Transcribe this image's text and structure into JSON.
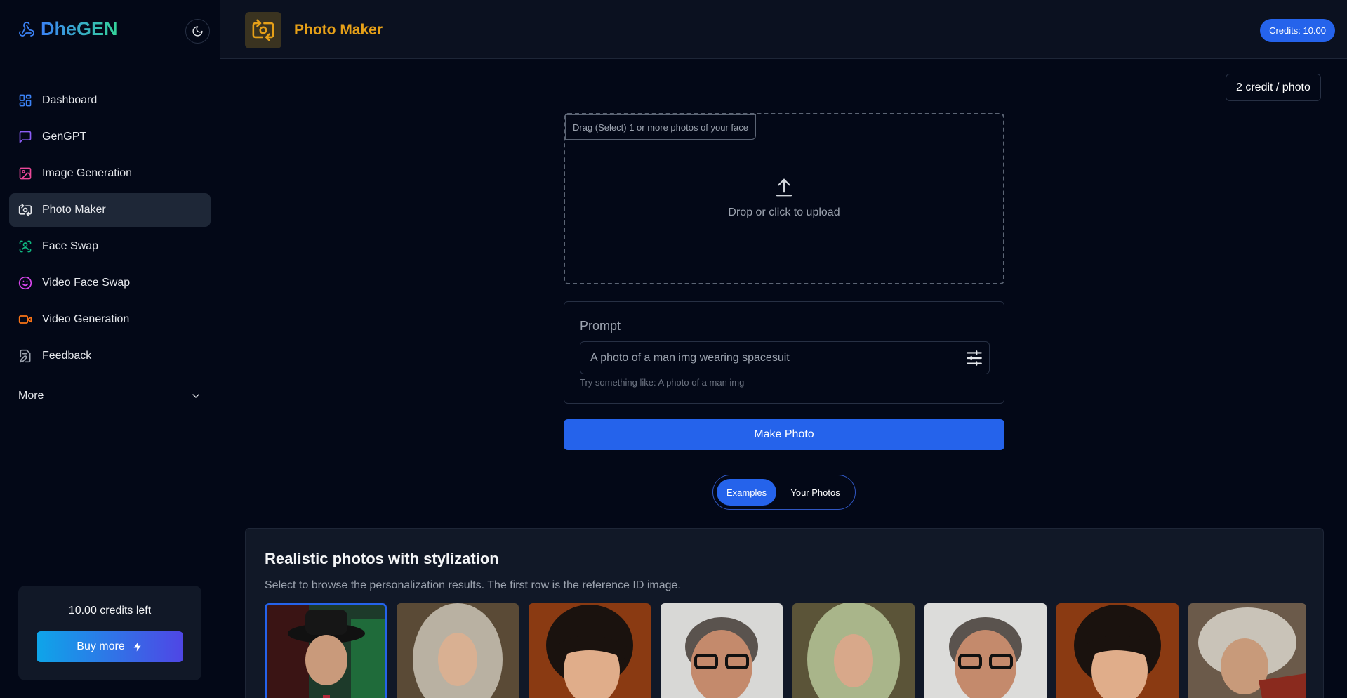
{
  "app": {
    "name": "DheGEN"
  },
  "sidebar": {
    "items": [
      {
        "label": "Dashboard",
        "icon": "dashboard-icon",
        "color": "#3b82f6"
      },
      {
        "label": "GenGPT",
        "icon": "chat-icon",
        "color": "#8b5cf6"
      },
      {
        "label": "Image Generation",
        "icon": "image-icon",
        "color": "#ec4899"
      },
      {
        "label": "Photo Maker",
        "icon": "photo-maker-icon",
        "color": "#e5e7eb"
      },
      {
        "label": "Face Swap",
        "icon": "face-scan-icon",
        "color": "#10b981"
      },
      {
        "label": "Video Face Swap",
        "icon": "smile-icon",
        "color": "#d946ef"
      },
      {
        "label": "Video Generation",
        "icon": "video-icon",
        "color": "#f97316"
      },
      {
        "label": "Feedback",
        "icon": "edit-icon",
        "color": "#9ca3af"
      }
    ],
    "more_label": "More",
    "credits_left": "10.00 credits left",
    "buy_more": "Buy more"
  },
  "header": {
    "title": "Photo Maker",
    "credits": "Credits: 10.00",
    "accent": "#e6a018"
  },
  "main": {
    "cost": "2 credit / photo",
    "upload": {
      "label": "Drag (Select) 1 or more photos of your face",
      "text": "Drop or click to upload"
    },
    "prompt": {
      "label": "Prompt",
      "value": "A photo of a man img wearing spacesuit",
      "hint": "Try something like: A photo of a man img"
    },
    "make_button": "Make Photo",
    "tabs": [
      {
        "label": "Examples",
        "active": true
      },
      {
        "label": "Your Photos",
        "active": false
      }
    ],
    "examples": {
      "title": "Realistic photos with stylization",
      "subtitle": "Select to browse the personalization results. The first row is the reference ID image."
    }
  }
}
